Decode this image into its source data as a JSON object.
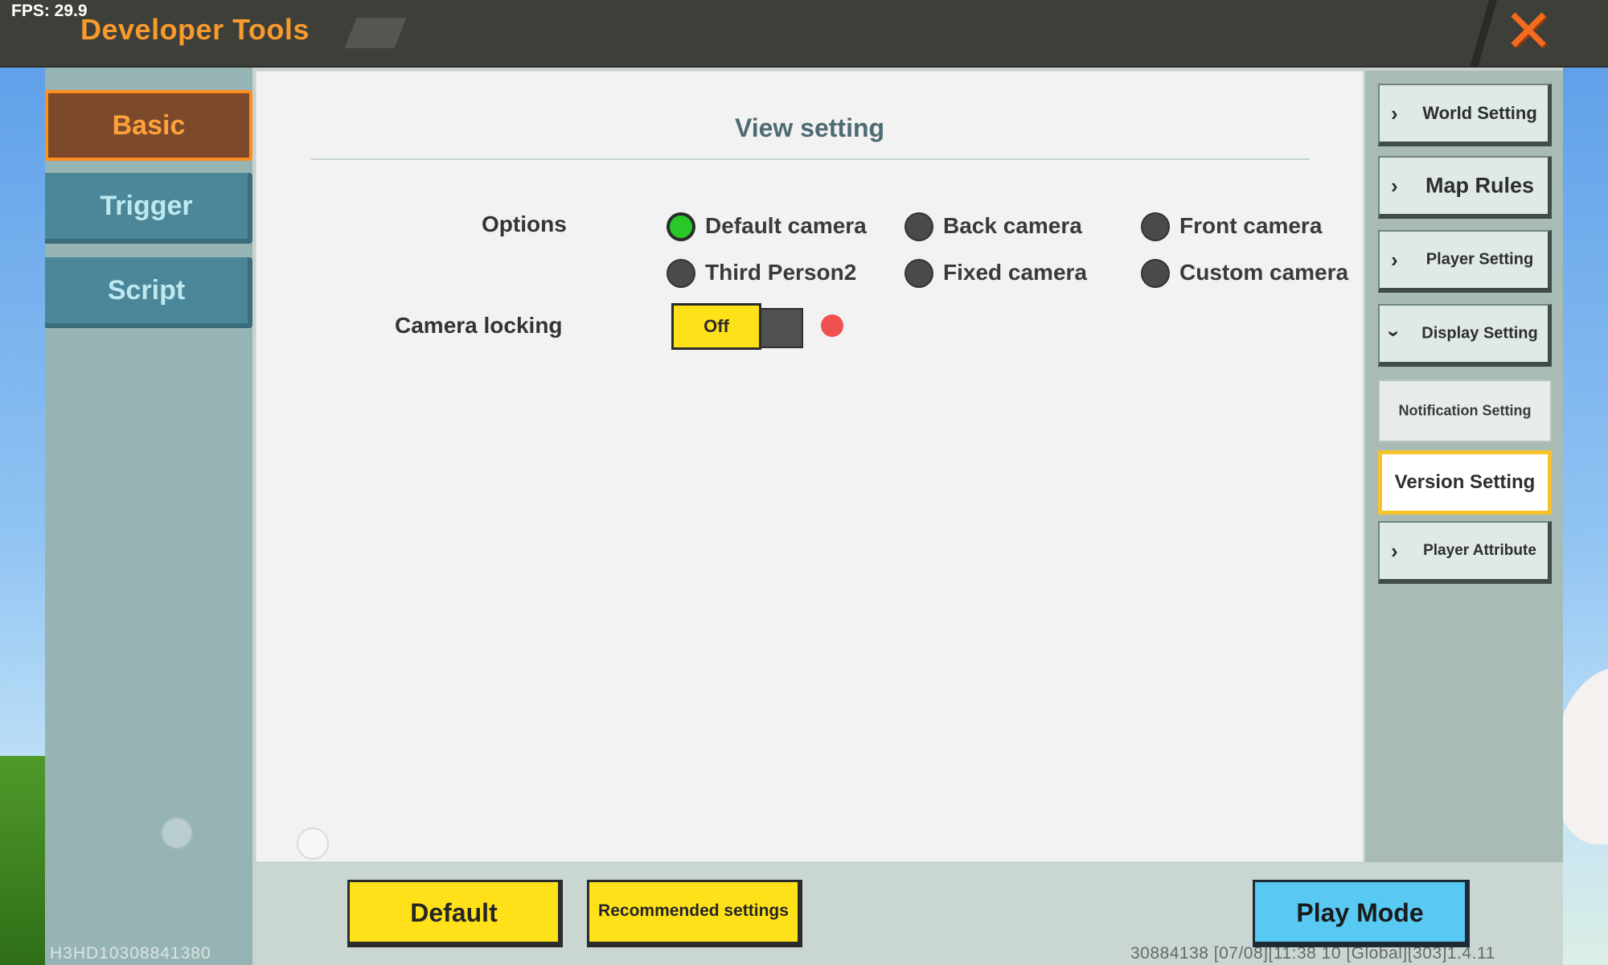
{
  "topbar": {
    "fps": "FPS: 29.9",
    "title": "Developer Tools",
    "close_icon": "close-x-icon",
    "accent": "#f89a2c"
  },
  "left_tabs": [
    {
      "label": "Basic",
      "active": true
    },
    {
      "label": "Trigger",
      "active": false
    },
    {
      "label": "Script",
      "active": false
    }
  ],
  "view": {
    "title": "View setting",
    "options_label": "Options",
    "camera_options": [
      {
        "label": "Default camera",
        "selected": true
      },
      {
        "label": "Back camera",
        "selected": false
      },
      {
        "label": "Front camera",
        "selected": false
      },
      {
        "label": "Third Person2",
        "selected": false
      },
      {
        "label": "Fixed camera",
        "selected": false
      },
      {
        "label": "Custom camera",
        "selected": false
      }
    ],
    "camera_locking_label": "Camera locking",
    "camera_locking_value": "Off"
  },
  "right_menu": [
    {
      "label": "World Setting",
      "icon": "chevron-right-icon",
      "state": "collapsed"
    },
    {
      "label": "Map Rules",
      "icon": "chevron-right-icon",
      "state": "collapsed"
    },
    {
      "label": "Player Setting",
      "icon": "chevron-right-icon",
      "state": "collapsed"
    },
    {
      "label": "Display Setting",
      "icon": "chevron-down-icon",
      "state": "expanded"
    },
    {
      "label": "Notification Setting",
      "icon": "",
      "state": "subitem"
    },
    {
      "label": "Version Setting",
      "icon": "",
      "state": "subitem-selected"
    },
    {
      "label": "Player Attribute",
      "icon": "chevron-right-icon",
      "state": "collapsed"
    }
  ],
  "bottom": {
    "default_label": "Default",
    "recommended_label": "Recommended settings",
    "play_label": "Play Mode"
  },
  "footer": {
    "left_code": "H3HD10308841380",
    "right_info": "30884138   [07/08][11:38 10  [Global][303]1.4.11"
  }
}
